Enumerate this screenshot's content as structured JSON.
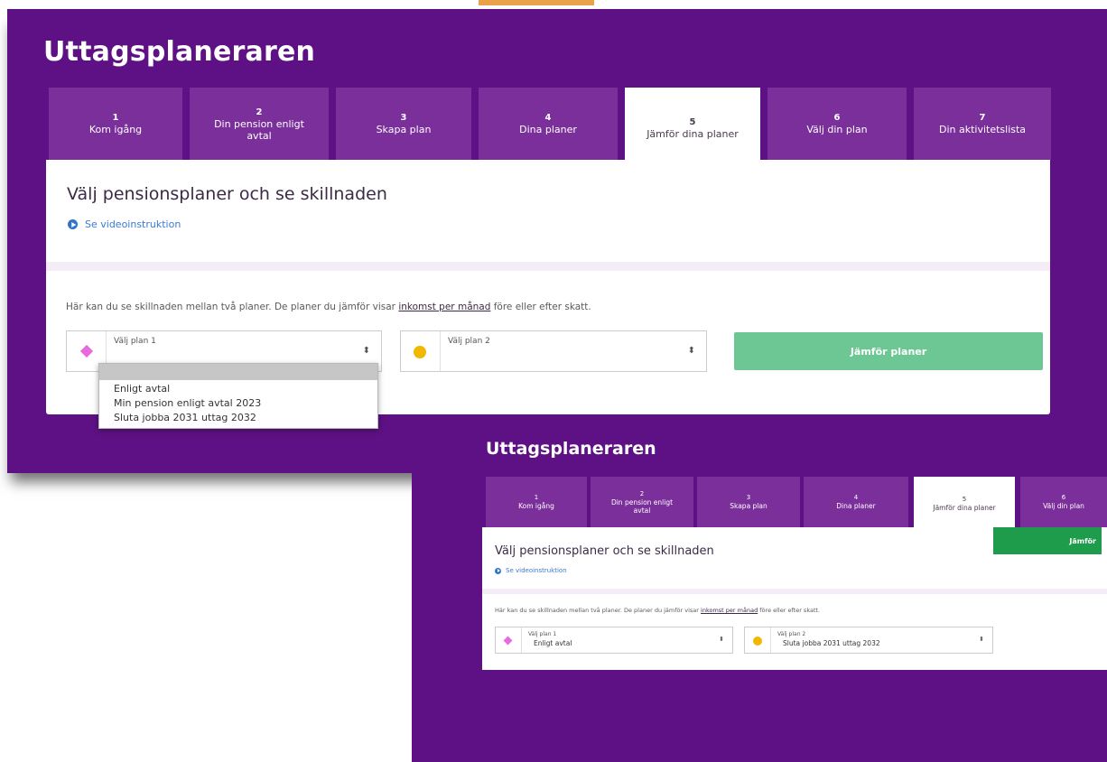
{
  "app_title": "Uttagsplaneraren",
  "tabs": [
    {
      "num": "1",
      "label": "Kom igång"
    },
    {
      "num": "2",
      "label": "Din pension enligt avtal"
    },
    {
      "num": "3",
      "label": "Skapa plan"
    },
    {
      "num": "4",
      "label": "Dina planer"
    },
    {
      "num": "5",
      "label": "Jämför dina planer"
    },
    {
      "num": "6",
      "label": "Välj din plan"
    },
    {
      "num": "7",
      "label": "Din aktivitetslista"
    }
  ],
  "active_tab_index": 4,
  "section": {
    "heading": "Välj pensionsplaner och se skillnaden",
    "video_link": "Se videoinstruktion",
    "intro_before": "Här kan du se skillnaden mellan två planer. De planer du jämför visar ",
    "intro_link": "inkomst per månad",
    "intro_after": " före eller efter skatt."
  },
  "plan1": {
    "label": "Välj plan 1",
    "color": "#e56bde",
    "icon": "diamond-icon"
  },
  "plan2": {
    "label": "Välj plan 2",
    "color": "#f0b800",
    "icon": "circle-icon"
  },
  "compare_button": "Jämför planer",
  "dropdown_options": [
    "Enligt avtal",
    "Min pension enligt avtal 2023",
    "Sluta jobba 2031 uttag 2032"
  ],
  "second_view": {
    "plan1_value": "Enligt avtal",
    "plan2_value": "Sluta jobba 2031 uttag 2032",
    "compare_button_visible": "Jämför"
  },
  "colors": {
    "brand_purple": "#5e1184",
    "tab_purple": "#7a2f9a",
    "link_blue": "#2f74c8",
    "compare_green_light": "#6cc794",
    "compare_green": "#1f9b4c"
  }
}
